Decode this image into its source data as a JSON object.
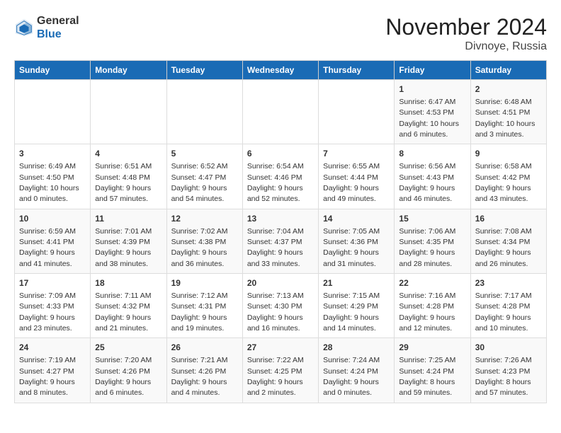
{
  "logo": {
    "general": "General",
    "blue": "Blue"
  },
  "title": "November 2024",
  "subtitle": "Divnoye, Russia",
  "headers": [
    "Sunday",
    "Monday",
    "Tuesday",
    "Wednesday",
    "Thursday",
    "Friday",
    "Saturday"
  ],
  "rows": [
    [
      {
        "day": "",
        "info": ""
      },
      {
        "day": "",
        "info": ""
      },
      {
        "day": "",
        "info": ""
      },
      {
        "day": "",
        "info": ""
      },
      {
        "day": "",
        "info": ""
      },
      {
        "day": "1",
        "info": "Sunrise: 6:47 AM\nSunset: 4:53 PM\nDaylight: 10 hours and 6 minutes."
      },
      {
        "day": "2",
        "info": "Sunrise: 6:48 AM\nSunset: 4:51 PM\nDaylight: 10 hours and 3 minutes."
      }
    ],
    [
      {
        "day": "3",
        "info": "Sunrise: 6:49 AM\nSunset: 4:50 PM\nDaylight: 10 hours and 0 minutes."
      },
      {
        "day": "4",
        "info": "Sunrise: 6:51 AM\nSunset: 4:48 PM\nDaylight: 9 hours and 57 minutes."
      },
      {
        "day": "5",
        "info": "Sunrise: 6:52 AM\nSunset: 4:47 PM\nDaylight: 9 hours and 54 minutes."
      },
      {
        "day": "6",
        "info": "Sunrise: 6:54 AM\nSunset: 4:46 PM\nDaylight: 9 hours and 52 minutes."
      },
      {
        "day": "7",
        "info": "Sunrise: 6:55 AM\nSunset: 4:44 PM\nDaylight: 9 hours and 49 minutes."
      },
      {
        "day": "8",
        "info": "Sunrise: 6:56 AM\nSunset: 4:43 PM\nDaylight: 9 hours and 46 minutes."
      },
      {
        "day": "9",
        "info": "Sunrise: 6:58 AM\nSunset: 4:42 PM\nDaylight: 9 hours and 43 minutes."
      }
    ],
    [
      {
        "day": "10",
        "info": "Sunrise: 6:59 AM\nSunset: 4:41 PM\nDaylight: 9 hours and 41 minutes."
      },
      {
        "day": "11",
        "info": "Sunrise: 7:01 AM\nSunset: 4:39 PM\nDaylight: 9 hours and 38 minutes."
      },
      {
        "day": "12",
        "info": "Sunrise: 7:02 AM\nSunset: 4:38 PM\nDaylight: 9 hours and 36 minutes."
      },
      {
        "day": "13",
        "info": "Sunrise: 7:04 AM\nSunset: 4:37 PM\nDaylight: 9 hours and 33 minutes."
      },
      {
        "day": "14",
        "info": "Sunrise: 7:05 AM\nSunset: 4:36 PM\nDaylight: 9 hours and 31 minutes."
      },
      {
        "day": "15",
        "info": "Sunrise: 7:06 AM\nSunset: 4:35 PM\nDaylight: 9 hours and 28 minutes."
      },
      {
        "day": "16",
        "info": "Sunrise: 7:08 AM\nSunset: 4:34 PM\nDaylight: 9 hours and 26 minutes."
      }
    ],
    [
      {
        "day": "17",
        "info": "Sunrise: 7:09 AM\nSunset: 4:33 PM\nDaylight: 9 hours and 23 minutes."
      },
      {
        "day": "18",
        "info": "Sunrise: 7:11 AM\nSunset: 4:32 PM\nDaylight: 9 hours and 21 minutes."
      },
      {
        "day": "19",
        "info": "Sunrise: 7:12 AM\nSunset: 4:31 PM\nDaylight: 9 hours and 19 minutes."
      },
      {
        "day": "20",
        "info": "Sunrise: 7:13 AM\nSunset: 4:30 PM\nDaylight: 9 hours and 16 minutes."
      },
      {
        "day": "21",
        "info": "Sunrise: 7:15 AM\nSunset: 4:29 PM\nDaylight: 9 hours and 14 minutes."
      },
      {
        "day": "22",
        "info": "Sunrise: 7:16 AM\nSunset: 4:28 PM\nDaylight: 9 hours and 12 minutes."
      },
      {
        "day": "23",
        "info": "Sunrise: 7:17 AM\nSunset: 4:28 PM\nDaylight: 9 hours and 10 minutes."
      }
    ],
    [
      {
        "day": "24",
        "info": "Sunrise: 7:19 AM\nSunset: 4:27 PM\nDaylight: 9 hours and 8 minutes."
      },
      {
        "day": "25",
        "info": "Sunrise: 7:20 AM\nSunset: 4:26 PM\nDaylight: 9 hours and 6 minutes."
      },
      {
        "day": "26",
        "info": "Sunrise: 7:21 AM\nSunset: 4:26 PM\nDaylight: 9 hours and 4 minutes."
      },
      {
        "day": "27",
        "info": "Sunrise: 7:22 AM\nSunset: 4:25 PM\nDaylight: 9 hours and 2 minutes."
      },
      {
        "day": "28",
        "info": "Sunrise: 7:24 AM\nSunset: 4:24 PM\nDaylight: 9 hours and 0 minutes."
      },
      {
        "day": "29",
        "info": "Sunrise: 7:25 AM\nSunset: 4:24 PM\nDaylight: 8 hours and 59 minutes."
      },
      {
        "day": "30",
        "info": "Sunrise: 7:26 AM\nSunset: 4:23 PM\nDaylight: 8 hours and 57 minutes."
      }
    ]
  ]
}
